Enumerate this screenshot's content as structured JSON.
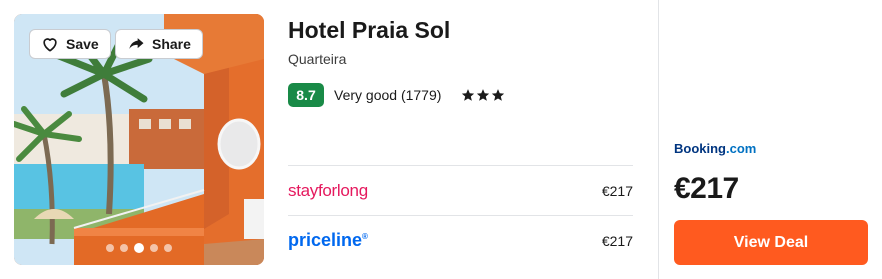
{
  "photo": {
    "save_label": "Save",
    "share_label": "Share",
    "dots_count": 5,
    "active_dot_index": 2
  },
  "hotel": {
    "name": "Hotel Praia Sol",
    "location": "Quarteira",
    "score": "8.7",
    "rating_text": "Very good (1779)",
    "stars": 3
  },
  "providers": [
    {
      "name": "stayforlong",
      "price": "€217"
    },
    {
      "name": "priceline",
      "price": "€217"
    }
  ],
  "deal": {
    "provider_name": "Booking",
    "provider_suffix": ".com",
    "price": "€217",
    "button_label": "View Deal"
  },
  "colors": {
    "score_bg": "#198a47",
    "cta": "#ff5a1f",
    "stayforlong": "#e5195e",
    "priceline": "#0068ef",
    "booking": "#003580"
  }
}
